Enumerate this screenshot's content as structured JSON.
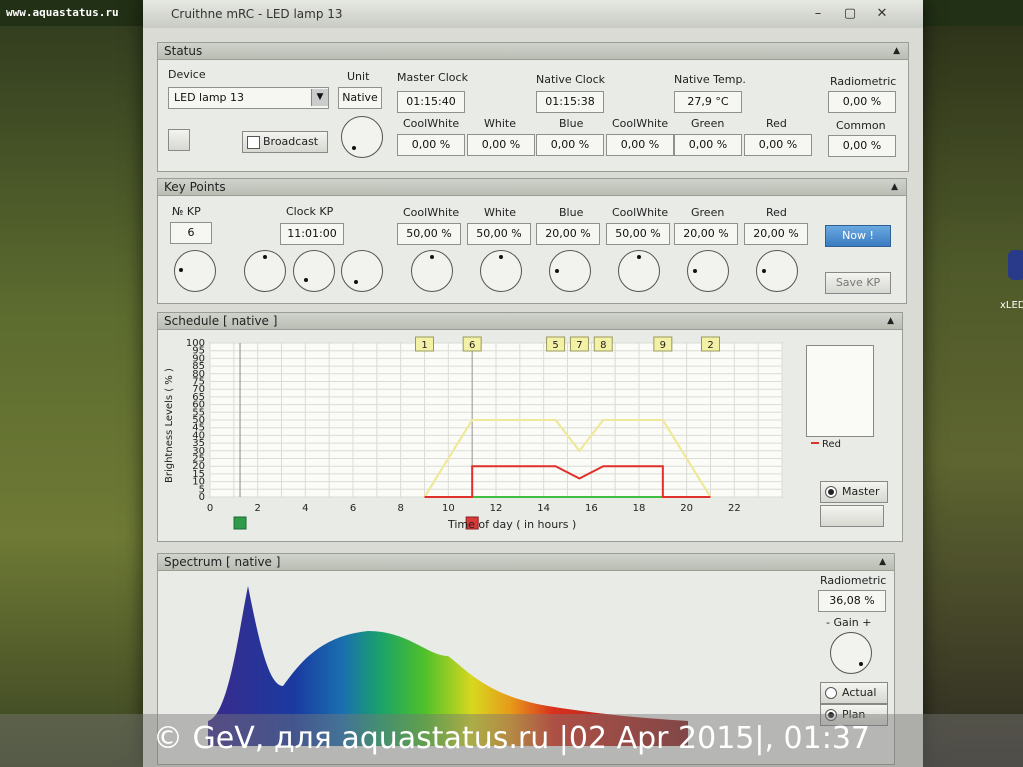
{
  "watermark_top": "www.aquastatus.ru",
  "side_label": "xLED",
  "window": {
    "title": "Cruithne mRC  -  LED lamp 13"
  },
  "status": {
    "header": "Status",
    "device_label": "Device",
    "device_value": "LED lamp 13",
    "unit_label": "Unit",
    "unit_value": "Native",
    "broadcast_label": "Broadcast",
    "master_clock_label": "Master Clock",
    "master_clock_value": "01:15:40",
    "native_clock_label": "Native  Clock",
    "native_clock_value": "01:15:38",
    "native_temp_label": "Native  Temp.",
    "native_temp_value": "27,9 °C",
    "radiometric_label": "Radiometric",
    "radiometric_value": "0,00 %",
    "common_label": "Common",
    "common_value": "0,00 %",
    "channels": [
      {
        "label": "CoolWhite",
        "value": "0,00 %"
      },
      {
        "label": "White",
        "value": "0,00 %"
      },
      {
        "label": "Blue",
        "value": "0,00 %"
      },
      {
        "label": "CoolWhite",
        "value": "0,00 %"
      },
      {
        "label": "Green",
        "value": "0,00 %"
      },
      {
        "label": "Red",
        "value": "0,00 %"
      }
    ]
  },
  "keypoints": {
    "header": "Key Points",
    "no_kp_label": "№  KP",
    "no_kp_value": "6",
    "clock_kp_label": "Clock  KP",
    "clock_kp_value": "11:01:00",
    "channels": [
      {
        "label": "CoolWhite",
        "value": "50,00 %"
      },
      {
        "label": "White",
        "value": "50,00 %"
      },
      {
        "label": "Blue",
        "value": "20,00 %"
      },
      {
        "label": "CoolWhite",
        "value": "50,00 %"
      },
      {
        "label": "Green",
        "value": "20,00 %"
      },
      {
        "label": "Red",
        "value": "20,00 %"
      }
    ],
    "now_button": "Now !",
    "save_button": "Save  KP"
  },
  "schedule": {
    "header": "Schedule  [ native ]",
    "ylabel": "Brightness Levels  ( % )",
    "xlabel": "Time of day   ( in hours )",
    "master_label": "Master",
    "markers": [
      "1",
      "6",
      "5",
      "7",
      "8",
      "9",
      "2"
    ]
  },
  "chart_data": {
    "type": "line",
    "xlim": [
      0,
      24
    ],
    "ylim": [
      0,
      100
    ],
    "x_ticks": [
      0,
      2,
      4,
      6,
      8,
      10,
      12,
      14,
      16,
      18,
      20,
      22
    ],
    "y_ticks": [
      0,
      5,
      10,
      15,
      20,
      25,
      30,
      35,
      40,
      45,
      50,
      55,
      60,
      65,
      70,
      75,
      80,
      85,
      90,
      95,
      100
    ],
    "xlabel": "Time of day   ( in hours )",
    "ylabel": "Brightness Levels  ( % )",
    "grid": true,
    "legend": "right",
    "markers_x": [
      9,
      11,
      14.5,
      15.5,
      16.5,
      19,
      21
    ],
    "series": [
      {
        "name": "CoolWhite",
        "color": "#f0ec9a",
        "x": [
          9,
          11,
          14.5,
          15.5,
          16.5,
          19,
          21
        ],
        "y": [
          0,
          50,
          50,
          30,
          50,
          50,
          0
        ]
      },
      {
        "name": "White",
        "color": "#f4f0a8",
        "x": [
          9,
          11,
          14.5,
          15.5,
          16.5,
          19,
          21
        ],
        "y": [
          0,
          50,
          50,
          30,
          50,
          50,
          0
        ]
      },
      {
        "name": "Blue",
        "color": "#2a4fa8",
        "x": [
          9,
          11,
          19,
          21
        ],
        "y": [
          0,
          0,
          0,
          0
        ]
      },
      {
        "name": "CoolWhite",
        "color": "#eee99a",
        "x": [
          9,
          11,
          14.5,
          15.5,
          16.5,
          19,
          21
        ],
        "y": [
          0,
          50,
          50,
          30,
          50,
          50,
          0
        ]
      },
      {
        "name": "Green",
        "color": "#3fbf3f",
        "x": [
          9,
          11,
          19,
          21
        ],
        "y": [
          0,
          0,
          0,
          0
        ]
      },
      {
        "name": "Red",
        "color": "#e0302a",
        "x": [
          9,
          11,
          11,
          14.5,
          15.5,
          16.5,
          19,
          19,
          21
        ],
        "y": [
          0,
          0,
          20,
          20,
          12,
          20,
          20,
          0,
          0
        ]
      }
    ]
  },
  "spectrum": {
    "header": "Spectrum  [ native ]",
    "radiometric_label": "Radiometric",
    "radiometric_value": "36,08 %",
    "gain_label": "-   Gain  +",
    "actual_label": "Actual",
    "plan_label": "Plan"
  },
  "watermark_bottom": "© GeV, для aquastatus.ru |02 Apr 2015|, 01:37"
}
